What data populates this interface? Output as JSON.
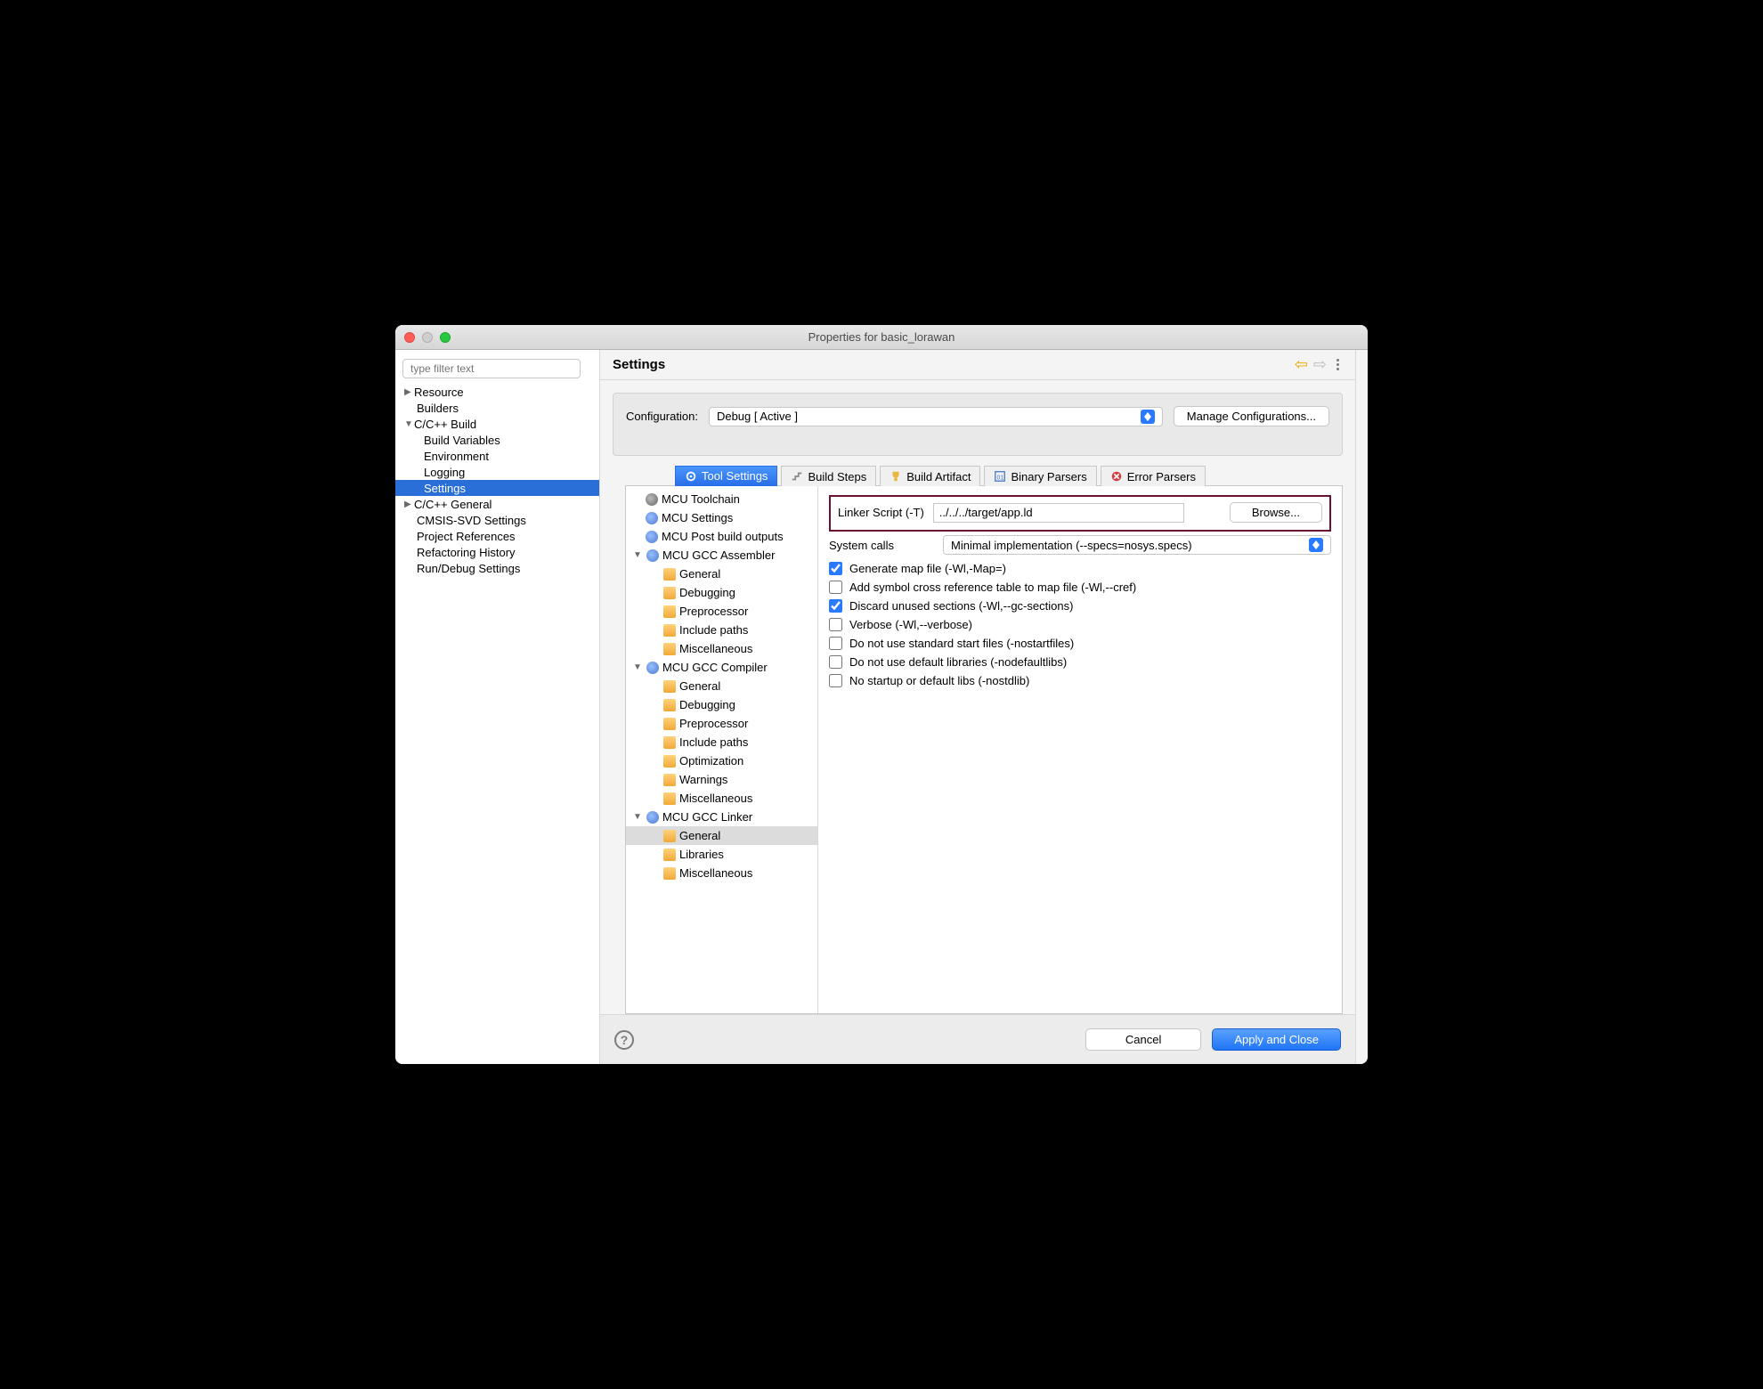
{
  "window": {
    "title": "Properties for basic_lorawan"
  },
  "sidebar": {
    "filter_placeholder": "type filter text",
    "items": {
      "resource": "Resource",
      "builders": "Builders",
      "cppbuild": "C/C++ Build",
      "build_vars": "Build Variables",
      "environment": "Environment",
      "logging": "Logging",
      "settings": "Settings",
      "cppgeneral": "C/C++ General",
      "cmsis": "CMSIS-SVD Settings",
      "projrefs": "Project References",
      "refactor": "Refactoring History",
      "rundebug": "Run/Debug Settings"
    }
  },
  "main": {
    "heading": "Settings",
    "config_label": "Configuration:",
    "config_value": "Debug  [ Active ]",
    "manage_btn": "Manage Configurations...",
    "tabs": {
      "tool": "Tool Settings",
      "steps": "Build Steps",
      "artifact": "Build Artifact",
      "binary": "Binary Parsers",
      "error": "Error Parsers"
    },
    "tool_tree": {
      "toolchain": "MCU Toolchain",
      "settings": "MCU Settings",
      "post": "MCU Post build outputs",
      "asm": "MCU GCC Assembler",
      "compiler": "MCU GCC Compiler",
      "linker": "MCU GCC Linker",
      "general": "General",
      "debugging": "Debugging",
      "preproc": "Preprocessor",
      "include": "Include paths",
      "misc": "Miscellaneous",
      "opt": "Optimization",
      "warn": "Warnings",
      "libs": "Libraries"
    },
    "form": {
      "linker_label": "Linker Script (-T)",
      "linker_value": "../../../target/app.ld",
      "browse": "Browse...",
      "syscalls_label": "System calls",
      "syscalls_value": "Minimal implementation (--specs=nosys.specs)",
      "cb_map": "Generate map file (-Wl,-Map=)",
      "cb_cref": "Add symbol cross reference table to map file (-Wl,--cref)",
      "cb_gc": "Discard unused sections (-Wl,--gc-sections)",
      "cb_verbose": "Verbose (-Wl,--verbose)",
      "cb_nostart": "Do not use standard start files (-nostartfiles)",
      "cb_nodeflibs": "Do not use default libraries (-nodefaultlibs)",
      "cb_nostdlib": "No startup or default libs (-nostdlib)"
    }
  },
  "footer": {
    "cancel": "Cancel",
    "apply": "Apply and Close"
  }
}
